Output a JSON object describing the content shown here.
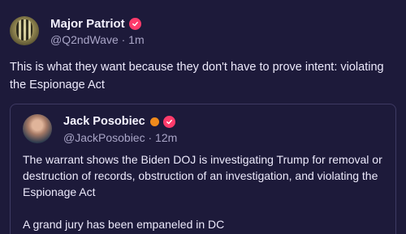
{
  "post": {
    "author": {
      "display_name": "Major Patriot",
      "handle": "@Q2ndWave",
      "time": "· 1m"
    },
    "text": "This is what they want because they don't have to prove intent:  violating the Espionage Act"
  },
  "quote": {
    "author": {
      "display_name": "Jack Posobiec",
      "handle": "@JackPosobiec",
      "time": "· 12m"
    },
    "paragraphs": [
      "The warrant shows the Biden DOJ is investigating Trump for removal or destruction of records, obstruction of an investigation, and violating the Espionage Act",
      "A grand jury has been empaneled in DC"
    ]
  },
  "colors": {
    "background": "#1d1a3a",
    "verified_badge": "#ff3b6b",
    "orange_badge": "#f08a1c",
    "muted_text": "#a9a5c7"
  },
  "icons": [
    "verified-badge-icon",
    "orange-dot-icon"
  ]
}
